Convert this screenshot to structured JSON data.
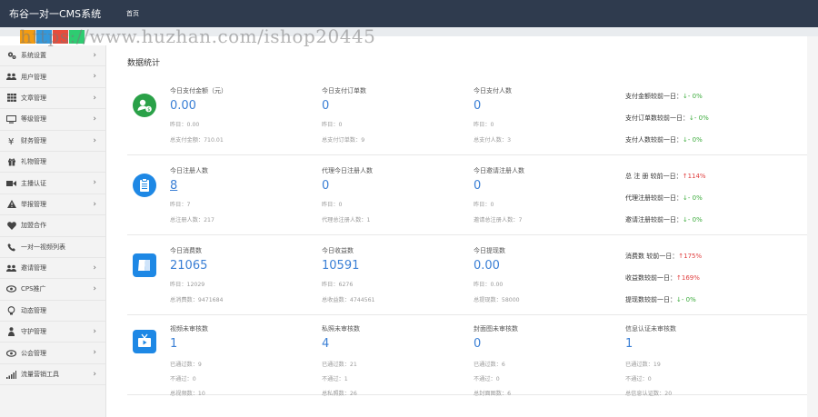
{
  "header": {
    "brand": "布谷一对一CMS系统",
    "home": "首页"
  },
  "watermark": "https://www.huzhan.com/ishop20445",
  "sidebar": {
    "items": [
      {
        "label": "系统设置",
        "icon": "gears-icon",
        "chevron": true
      },
      {
        "label": "用户管理",
        "icon": "users-icon",
        "chevron": true
      },
      {
        "label": "文章管理",
        "icon": "grid-icon",
        "chevron": true
      },
      {
        "label": "等级管理",
        "icon": "monitor-icon",
        "chevron": true
      },
      {
        "label": "财务管理",
        "icon": "yen-icon",
        "chevron": true
      },
      {
        "label": "礼物管理",
        "icon": "gift-icon",
        "chevron": false
      },
      {
        "label": "主播认证",
        "icon": "video-icon",
        "chevron": true
      },
      {
        "label": "举报管理",
        "icon": "warning-icon",
        "chevron": true
      },
      {
        "label": "加盟合作",
        "icon": "heart-icon",
        "chevron": false
      },
      {
        "label": "一对一视频列表",
        "icon": "call-icon",
        "chevron": false
      },
      {
        "label": "邀请管理",
        "icon": "invite-icon",
        "chevron": true
      },
      {
        "label": "CPS推广",
        "icon": "eye-icon",
        "chevron": true
      },
      {
        "label": "动态管理",
        "icon": "bulb-icon",
        "chevron": false
      },
      {
        "label": "守护管理",
        "icon": "guard-icon",
        "chevron": true
      },
      {
        "label": "公会管理",
        "icon": "guild-icon",
        "chevron": true
      },
      {
        "label": "流量营销工具",
        "icon": "signal-icon",
        "chevron": true
      }
    ]
  },
  "page_title": "数据统计",
  "colors": {
    "accent": "#3a7fd5",
    "green": "#2aa148",
    "blue": "#1e88e5",
    "up": "#e04040",
    "down": "#3cab3c",
    "header": "#2f3b4e"
  },
  "rows": [
    {
      "icon": "money-user-icon",
      "icon_color": "#2aa148",
      "stats": [
        {
          "title": "今日支付金额（元）",
          "value": "0.00",
          "subs": [
            "昨日：0.00",
            "总支付金额：710.01"
          ]
        },
        {
          "title": "今日支付订单数",
          "value": "0",
          "subs": [
            "昨日：0",
            "总支付订单数：9"
          ]
        },
        {
          "title": "今日支付人数",
          "value": "0",
          "subs": [
            "昨日：0",
            "总支付人数：3"
          ]
        }
      ],
      "compare": [
        {
          "label": "支付金额较前一日：",
          "arrow": "↓",
          "dir": "dn",
          "pct": "- 0%"
        },
        {
          "label": "支付订单数较前一日：",
          "arrow": "↓",
          "dir": "dn",
          "pct": "- 0%"
        },
        {
          "label": "支付人数较前一日：",
          "arrow": "↓",
          "dir": "dn",
          "pct": "- 0%"
        }
      ]
    },
    {
      "icon": "clipboard-icon",
      "icon_color": "#1e88e5",
      "stats": [
        {
          "title": "今日注册人数",
          "value": "8",
          "underline": true,
          "subs": [
            "昨日：7",
            "总注册人数：217"
          ]
        },
        {
          "title": "代理今日注册人数",
          "value": "0",
          "subs": [
            "昨日：0",
            "代理总注册人数：1"
          ]
        },
        {
          "title": "今日邀请注册人数",
          "value": "0",
          "subs": [
            "昨日：0",
            "邀请总注册人数：7"
          ]
        }
      ],
      "compare": [
        {
          "label": "总 注 册 较前一日：",
          "arrow": "↑",
          "dir": "up",
          "pct": "114%"
        },
        {
          "label": "代理注册较前一日：",
          "arrow": "↓",
          "dir": "dn",
          "pct": "- 0%"
        },
        {
          "label": "邀请注册较前一日：",
          "arrow": "↓",
          "dir": "dn",
          "pct": "- 0%"
        }
      ]
    },
    {
      "icon": "book-icon",
      "icon_color": "#1e88e5",
      "stats": [
        {
          "title": "今日消费数",
          "value": "21065",
          "subs": [
            "昨日：12029",
            "总消费数：9471684"
          ]
        },
        {
          "title": "今日收益数",
          "value": "10591",
          "subs": [
            "昨日：6276",
            "总收益数：4744561"
          ]
        },
        {
          "title": "今日提现数",
          "value": "0.00",
          "subs": [
            "昨日：0.00",
            "总提现数：58000"
          ]
        }
      ],
      "compare": [
        {
          "label": "消费数 较前一日：",
          "arrow": "↑",
          "dir": "up",
          "pct": "175%"
        },
        {
          "label": "收益数较前一日：",
          "arrow": "↑",
          "dir": "up",
          "pct": "169%"
        },
        {
          "label": "提现数较前一日：",
          "arrow": "↓",
          "dir": "dn",
          "pct": "- 0%"
        }
      ]
    },
    {
      "icon": "tv-icon",
      "icon_color": "#1e88e5",
      "stats": [
        {
          "title": "视频未审核数",
          "value": "1",
          "subs": [
            "已通过数：9",
            "不通过：0",
            "总视频数：10"
          ]
        },
        {
          "title": "私照未审核数",
          "value": "4",
          "subs": [
            "已通过数：21",
            "不通过：1",
            "总私照数：26"
          ]
        },
        {
          "title": "封面图未审核数",
          "value": "0",
          "subs": [
            "已通过数：6",
            "不通过：0",
            "总封面图数：6"
          ]
        },
        {
          "title": "信息认证未审核数",
          "value": "1",
          "subs": [
            "已通过数：19",
            "不通过：0",
            "总信息认证数：20"
          ]
        }
      ],
      "compare": []
    }
  ]
}
